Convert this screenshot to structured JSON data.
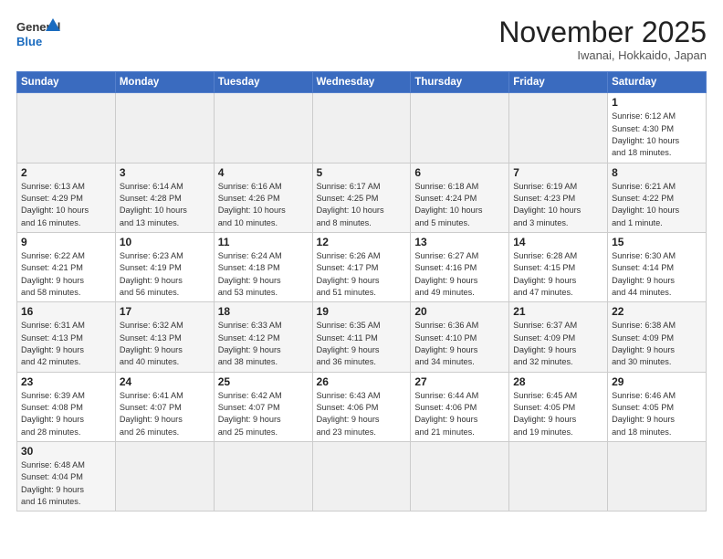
{
  "header": {
    "logo_general": "General",
    "logo_blue": "Blue",
    "month_title": "November 2025",
    "subtitle": "Iwanai, Hokkaido, Japan"
  },
  "weekdays": [
    "Sunday",
    "Monday",
    "Tuesday",
    "Wednesday",
    "Thursday",
    "Friday",
    "Saturday"
  ],
  "weeks": [
    [
      {
        "day": "",
        "info": ""
      },
      {
        "day": "",
        "info": ""
      },
      {
        "day": "",
        "info": ""
      },
      {
        "day": "",
        "info": ""
      },
      {
        "day": "",
        "info": ""
      },
      {
        "day": "",
        "info": ""
      },
      {
        "day": "1",
        "info": "Sunrise: 6:12 AM\nSunset: 4:30 PM\nDaylight: 10 hours\nand 18 minutes."
      }
    ],
    [
      {
        "day": "2",
        "info": "Sunrise: 6:13 AM\nSunset: 4:29 PM\nDaylight: 10 hours\nand 16 minutes."
      },
      {
        "day": "3",
        "info": "Sunrise: 6:14 AM\nSunset: 4:28 PM\nDaylight: 10 hours\nand 13 minutes."
      },
      {
        "day": "4",
        "info": "Sunrise: 6:16 AM\nSunset: 4:26 PM\nDaylight: 10 hours\nand 10 minutes."
      },
      {
        "day": "5",
        "info": "Sunrise: 6:17 AM\nSunset: 4:25 PM\nDaylight: 10 hours\nand 8 minutes."
      },
      {
        "day": "6",
        "info": "Sunrise: 6:18 AM\nSunset: 4:24 PM\nDaylight: 10 hours\nand 5 minutes."
      },
      {
        "day": "7",
        "info": "Sunrise: 6:19 AM\nSunset: 4:23 PM\nDaylight: 10 hours\nand 3 minutes."
      },
      {
        "day": "8",
        "info": "Sunrise: 6:21 AM\nSunset: 4:22 PM\nDaylight: 10 hours\nand 1 minute."
      }
    ],
    [
      {
        "day": "9",
        "info": "Sunrise: 6:22 AM\nSunset: 4:21 PM\nDaylight: 9 hours\nand 58 minutes."
      },
      {
        "day": "10",
        "info": "Sunrise: 6:23 AM\nSunset: 4:19 PM\nDaylight: 9 hours\nand 56 minutes."
      },
      {
        "day": "11",
        "info": "Sunrise: 6:24 AM\nSunset: 4:18 PM\nDaylight: 9 hours\nand 53 minutes."
      },
      {
        "day": "12",
        "info": "Sunrise: 6:26 AM\nSunset: 4:17 PM\nDaylight: 9 hours\nand 51 minutes."
      },
      {
        "day": "13",
        "info": "Sunrise: 6:27 AM\nSunset: 4:16 PM\nDaylight: 9 hours\nand 49 minutes."
      },
      {
        "day": "14",
        "info": "Sunrise: 6:28 AM\nSunset: 4:15 PM\nDaylight: 9 hours\nand 47 minutes."
      },
      {
        "day": "15",
        "info": "Sunrise: 6:30 AM\nSunset: 4:14 PM\nDaylight: 9 hours\nand 44 minutes."
      }
    ],
    [
      {
        "day": "16",
        "info": "Sunrise: 6:31 AM\nSunset: 4:13 PM\nDaylight: 9 hours\nand 42 minutes."
      },
      {
        "day": "17",
        "info": "Sunrise: 6:32 AM\nSunset: 4:13 PM\nDaylight: 9 hours\nand 40 minutes."
      },
      {
        "day": "18",
        "info": "Sunrise: 6:33 AM\nSunset: 4:12 PM\nDaylight: 9 hours\nand 38 minutes."
      },
      {
        "day": "19",
        "info": "Sunrise: 6:35 AM\nSunset: 4:11 PM\nDaylight: 9 hours\nand 36 minutes."
      },
      {
        "day": "20",
        "info": "Sunrise: 6:36 AM\nSunset: 4:10 PM\nDaylight: 9 hours\nand 34 minutes."
      },
      {
        "day": "21",
        "info": "Sunrise: 6:37 AM\nSunset: 4:09 PM\nDaylight: 9 hours\nand 32 minutes."
      },
      {
        "day": "22",
        "info": "Sunrise: 6:38 AM\nSunset: 4:09 PM\nDaylight: 9 hours\nand 30 minutes."
      }
    ],
    [
      {
        "day": "23",
        "info": "Sunrise: 6:39 AM\nSunset: 4:08 PM\nDaylight: 9 hours\nand 28 minutes."
      },
      {
        "day": "24",
        "info": "Sunrise: 6:41 AM\nSunset: 4:07 PM\nDaylight: 9 hours\nand 26 minutes."
      },
      {
        "day": "25",
        "info": "Sunrise: 6:42 AM\nSunset: 4:07 PM\nDaylight: 9 hours\nand 25 minutes."
      },
      {
        "day": "26",
        "info": "Sunrise: 6:43 AM\nSunset: 4:06 PM\nDaylight: 9 hours\nand 23 minutes."
      },
      {
        "day": "27",
        "info": "Sunrise: 6:44 AM\nSunset: 4:06 PM\nDaylight: 9 hours\nand 21 minutes."
      },
      {
        "day": "28",
        "info": "Sunrise: 6:45 AM\nSunset: 4:05 PM\nDaylight: 9 hours\nand 19 minutes."
      },
      {
        "day": "29",
        "info": "Sunrise: 6:46 AM\nSunset: 4:05 PM\nDaylight: 9 hours\nand 18 minutes."
      }
    ],
    [
      {
        "day": "30",
        "info": "Sunrise: 6:48 AM\nSunset: 4:04 PM\nDaylight: 9 hours\nand 16 minutes."
      },
      {
        "day": "",
        "info": ""
      },
      {
        "day": "",
        "info": ""
      },
      {
        "day": "",
        "info": ""
      },
      {
        "day": "",
        "info": ""
      },
      {
        "day": "",
        "info": ""
      },
      {
        "day": "",
        "info": ""
      }
    ]
  ]
}
